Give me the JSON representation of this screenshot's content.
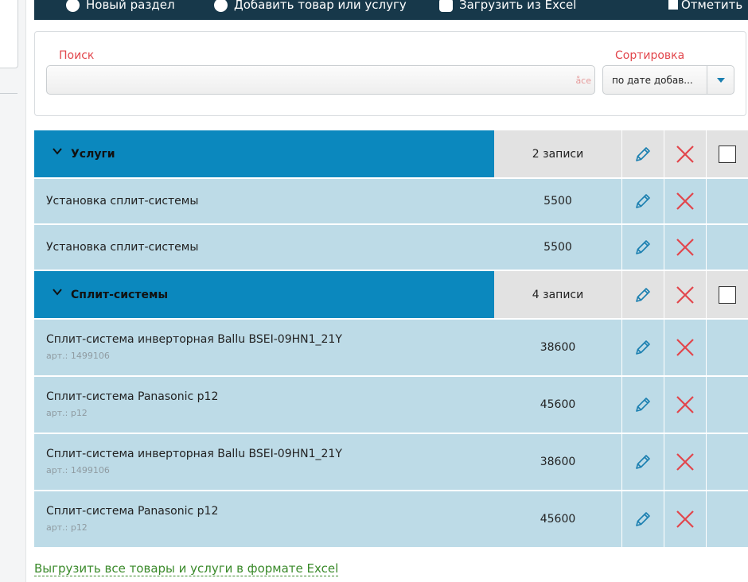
{
  "toolbar": {
    "new_section": "Новый раздел",
    "add_item": "Добавить товар или услугу",
    "import_excel": "Загрузить из Excel",
    "mark_all": "Отметить"
  },
  "search": {
    "label": "Поиск",
    "value": "",
    "hint": "åce",
    "sort_label": "Сортировка",
    "sort_value": "по дате добав..."
  },
  "groups": [
    {
      "title": "Услуги",
      "count": "2 записи",
      "items": [
        {
          "title": "Установка сплит-системы",
          "price": "5500"
        },
        {
          "title": "Установка сплит-системы",
          "price": "5500"
        }
      ]
    },
    {
      "title": "Сплит-системы",
      "count": "4 записи",
      "items": [
        {
          "title": "Сплит-система инверторная Ballu BSEI-09HN1_21Y",
          "sku": "арт.: 1499106",
          "price": "38600"
        },
        {
          "title": "Сплит-система Panasonic p12",
          "sku": "арт.: p12",
          "price": "45600"
        },
        {
          "title": "Сплит-система инверторная Ballu BSEI-09HN1_21Y",
          "sku": "арт.: 1499106",
          "price": "38600"
        },
        {
          "title": "Сплит-система Panasonic p12",
          "sku": "арт.: p12",
          "price": "45600"
        }
      ]
    }
  ],
  "export_link": "Выгрузить все товары и услуги в формате Excel",
  "colors": {
    "toolbar_bg": "#17384a",
    "group_header": "#0b88be",
    "row_bg": "#bddbe7",
    "edit_icon": "#1a7fb0",
    "delete_icon": "#e2464c",
    "label_red": "#e2464c",
    "link_green": "#3a8a2a"
  },
  "icons": {
    "edit": "pencil-icon",
    "delete": "close-icon",
    "expand": "chevron-down-icon"
  }
}
